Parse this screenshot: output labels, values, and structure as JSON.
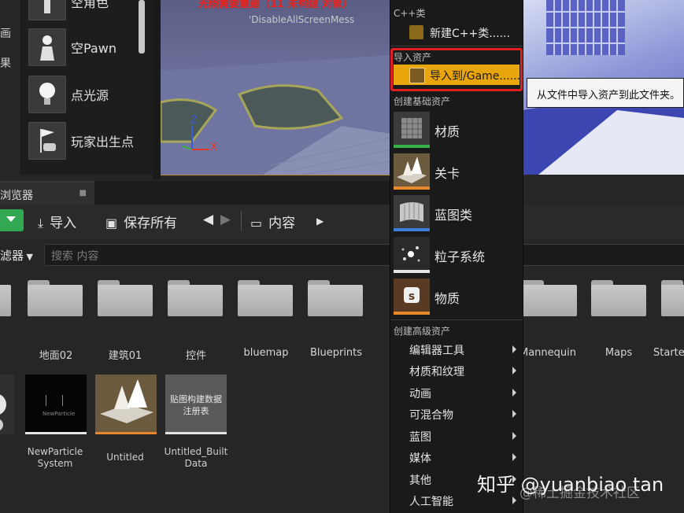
{
  "place_panel": {
    "left_labels": [
      "画",
      "果"
    ],
    "items": [
      {
        "label": "空角色",
        "icon": "character-icon"
      },
      {
        "label": "空Pawn",
        "icon": "pawn-icon"
      },
      {
        "label": "点光源",
        "icon": "point-light-icon"
      },
      {
        "label": "玩家出生点",
        "icon": "player-start-icon"
      }
    ]
  },
  "viewport": {
    "warning": "光照需要重建（11 未构建 对象）",
    "disable_msg": "'DisableAllScreenMess",
    "axis_z": "Z",
    "axis_x": "X"
  },
  "content_browser": {
    "tab_title": "浏览器",
    "toolbar": {
      "import_label": "导入",
      "save_all_label": "保存所有",
      "path_label": "内容"
    },
    "filters_label": "滤器",
    "search_placeholder": "搜索 内容",
    "folders_left": [
      "地面02",
      "建筑01",
      "控件",
      "bluemap",
      "Blueprints"
    ],
    "folders_right": [
      "Mannequin",
      "Maps",
      "Starte"
    ],
    "assets": [
      {
        "label": "NewParticle System",
        "bar_color": "#e4e4e4",
        "tile_text": "NewParticle"
      },
      {
        "label": "Untitled",
        "bar_color": "#e8882a"
      },
      {
        "label": "Untitled_Built Data",
        "bar_color": "#e4e4e4",
        "tile_text": "贴图构建数据注册表"
      }
    ]
  },
  "context_menu": {
    "section_cpp": "C++类",
    "new_cpp_class": "新建C++类......",
    "section_import": "导入资产",
    "import_to": "导入到/Game......",
    "section_basic": "创建基础资产",
    "basic": [
      {
        "label": "材质",
        "icon": "material-icon",
        "strip": "#36b04a"
      },
      {
        "label": "关卡",
        "icon": "level-icon",
        "strip": "#e8882a"
      },
      {
        "label": "蓝图类",
        "icon": "blueprint-class-icon",
        "strip": "#3b7dd8"
      },
      {
        "label": "粒子系统",
        "icon": "particle-system-icon",
        "strip": "#e4e4e4"
      },
      {
        "label": "物质",
        "icon": "substance-icon",
        "strip": "#e8882a"
      }
    ],
    "section_advanced": "创建高级资产",
    "advanced": [
      "编辑器工具",
      "材质和纹理",
      "动画",
      "可混合物",
      "蓝图",
      "媒体",
      "其他",
      "人工智能"
    ]
  },
  "tooltip": "从文件中导入资产到此文件夹。",
  "watermark": "知乎 @yuanbiao tan",
  "watermark_sub": "@稀土掘金技术社区",
  "colors": {
    "highlight": "#e9a50c",
    "red_box": "#e02020",
    "green_button": "#33a852"
  }
}
